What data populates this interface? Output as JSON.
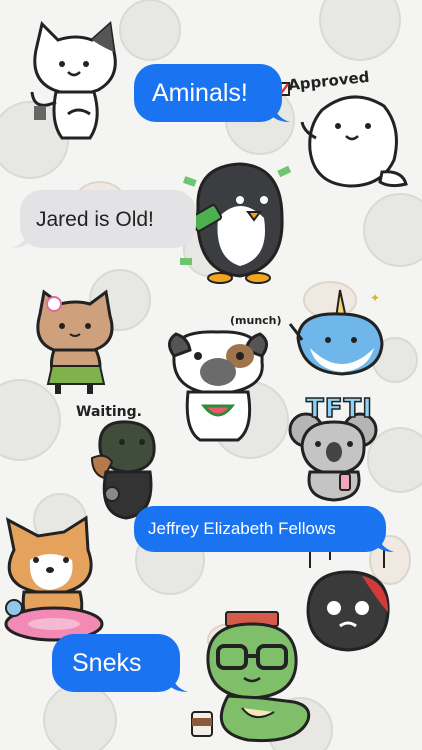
{
  "messages": {
    "aminals": "Aminals!",
    "jared": "Jared is Old!",
    "jeffrey": "Jeffrey Elizabeth Fellows",
    "sneks": "Sneks"
  },
  "sticker_labels": {
    "approved": "Approved",
    "munch": "(munch)",
    "waiting": "Waiting.",
    "tfti": "TFTI"
  },
  "colors": {
    "bubble_blue": "#1a73f0",
    "bubble_gray": "#e3e3e6",
    "background": "#f4f4f2",
    "tfti_blue": "#8fd0f5"
  }
}
